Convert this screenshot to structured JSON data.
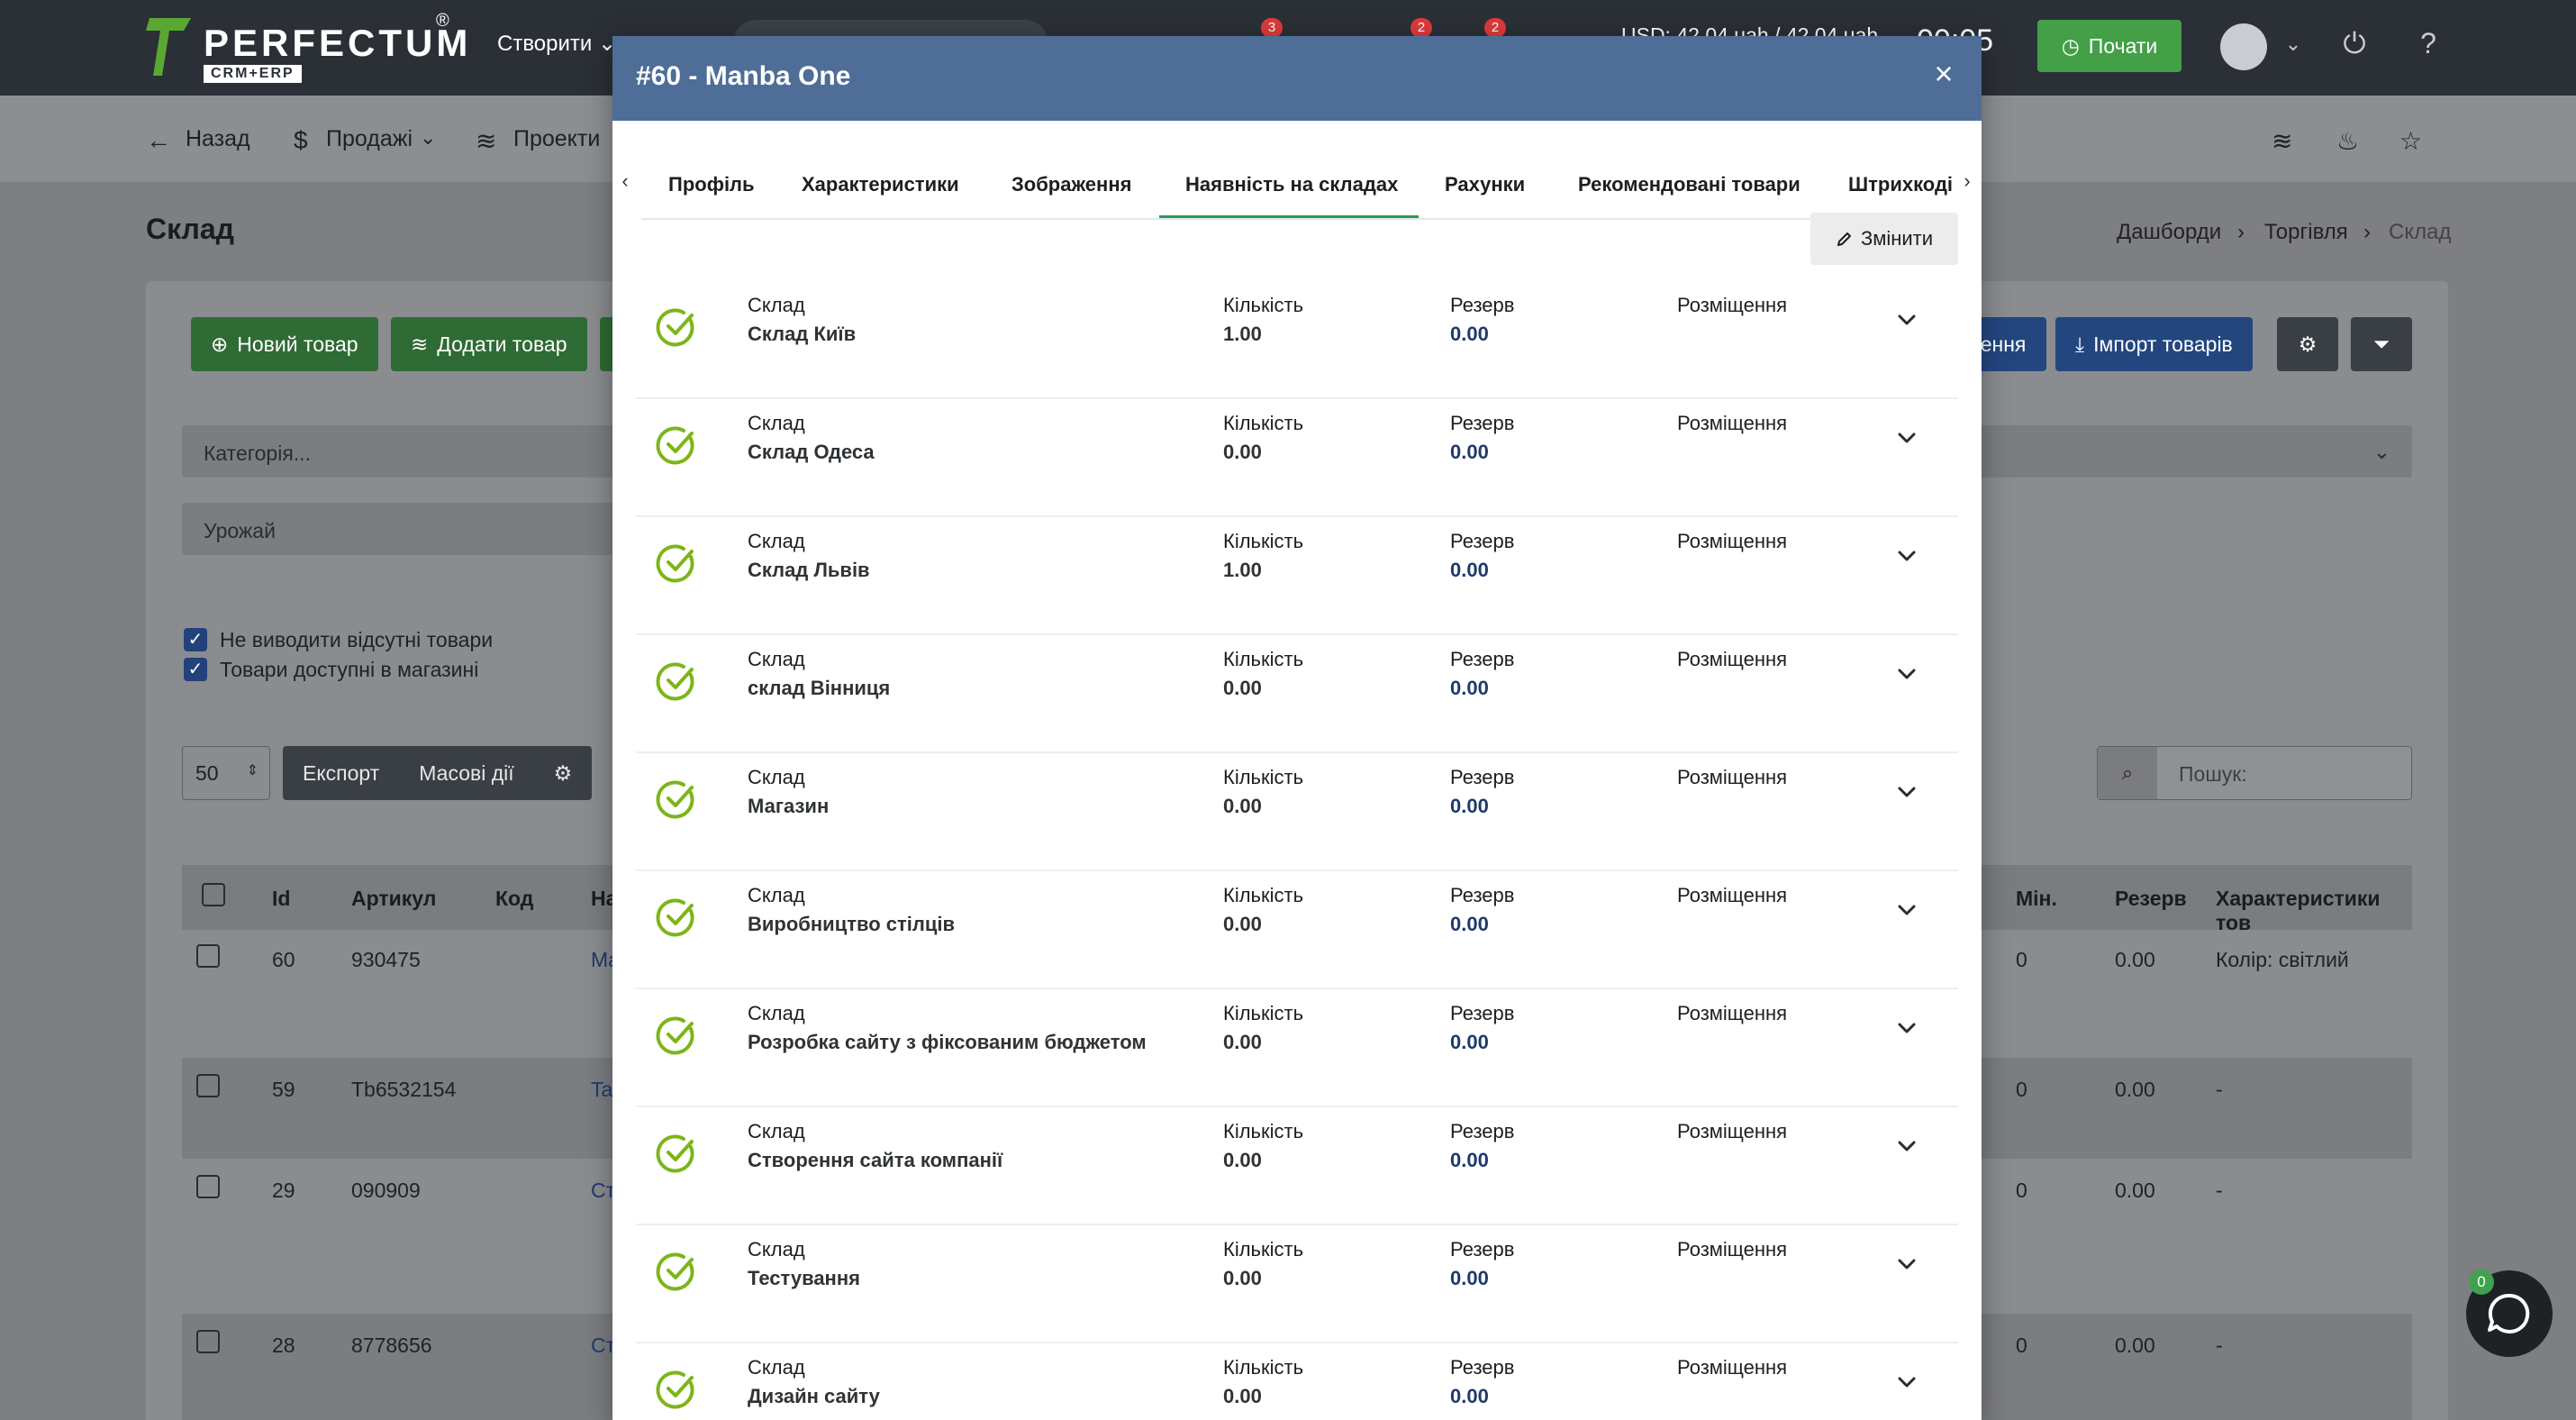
{
  "app": {
    "logo_title": "PERFECTUM",
    "logo_sub": "CRM+ERP",
    "logo_reg": "®",
    "create_label": "Створити",
    "badges": [
      "3",
      "2",
      "2"
    ],
    "rate_text": "USD: 42.04 uah / 42.04 uah",
    "clock_text": "00:05",
    "start_label": "Почати"
  },
  "subnav": {
    "back_label": "Назад",
    "sales_label": "Продажі",
    "projects_label": "Проекти"
  },
  "page": {
    "title": "Склад",
    "breadcrumbs": [
      "Дашборди",
      "Торгівля",
      "Склад"
    ]
  },
  "toolbar": {
    "new_product": "Новий товар",
    "add_product": "Додати товар",
    "partial_button": "нення",
    "import_products": "Імпорт товарів",
    "category_placeholder": "Категорія...",
    "harvest_value": "Урожай",
    "check_hide_absent": "Не виводити відсутні товари",
    "check_available_shop": "Товари доступні в магазині",
    "per_page": "50",
    "export_label": "Експорт",
    "bulk_label": "Масові дії",
    "search_placeholder": "Пошук:"
  },
  "table": {
    "headers": {
      "id": "Id",
      "sku": "Артикул",
      "code": "Код",
      "name": "На",
      "min": "Мін.",
      "reserve": "Резерв",
      "characteristics": "Характеристики тов"
    },
    "rows": [
      {
        "id": "60",
        "sku": "930475",
        "name": "Ma",
        "min": "0",
        "reserve": "0.00",
        "char": "Колір: світлий"
      },
      {
        "id": "59",
        "sku": "Tb6532154",
        "name": "Ta",
        "min": "0",
        "reserve": "0.00",
        "char": "-"
      },
      {
        "id": "29",
        "sku": "090909",
        "name": "Ст",
        "min": "0",
        "reserve": "0.00",
        "char": "-"
      },
      {
        "id": "28",
        "sku": "8778656",
        "name": "Ст",
        "min": "0",
        "reserve": "0.00",
        "char": "-"
      }
    ]
  },
  "chat": {
    "count": "0"
  },
  "modal": {
    "title": "#60 - Manba One",
    "close": "×",
    "tabs": [
      "Профіль",
      "Характеристики",
      "Зображення",
      "Наявність на складах",
      "Рахунки",
      "Рекомендовані товари",
      "Штрихкоді"
    ],
    "active_tab": "Наявність на складах",
    "edit_label": "Змінити",
    "labels": {
      "warehouse": "Склад",
      "quantity": "Кількість",
      "reserve": "Резерв",
      "placement": "Розміщення"
    },
    "warehouses": [
      {
        "name": "Склад Київ",
        "quantity": "1.00",
        "reserve": "0.00"
      },
      {
        "name": "Склад Одеса",
        "quantity": "0.00",
        "reserve": "0.00"
      },
      {
        "name": "Склад Львів",
        "quantity": "1.00",
        "reserve": "0.00"
      },
      {
        "name": "склад Вінниця",
        "quantity": "0.00",
        "reserve": "0.00"
      },
      {
        "name": "Магазин",
        "quantity": "0.00",
        "reserve": "0.00"
      },
      {
        "name": "Виробництво стілців",
        "quantity": "0.00",
        "reserve": "0.00"
      },
      {
        "name": "Розробка сайту з фіксованим бюджетом",
        "quantity": "0.00",
        "reserve": "0.00"
      },
      {
        "name": "Створення сайта компанії",
        "quantity": "0.00",
        "reserve": "0.00"
      },
      {
        "name": "Тестування",
        "quantity": "0.00",
        "reserve": "0.00"
      },
      {
        "name": "Дизайн сайту",
        "quantity": "0.00",
        "reserve": "0.00"
      }
    ]
  },
  "colors": {
    "accent_green": "#2c9a54",
    "check_green": "#7cb518",
    "modal_header": "#4e6d97",
    "reserve_blue": "#1f3a6b"
  }
}
